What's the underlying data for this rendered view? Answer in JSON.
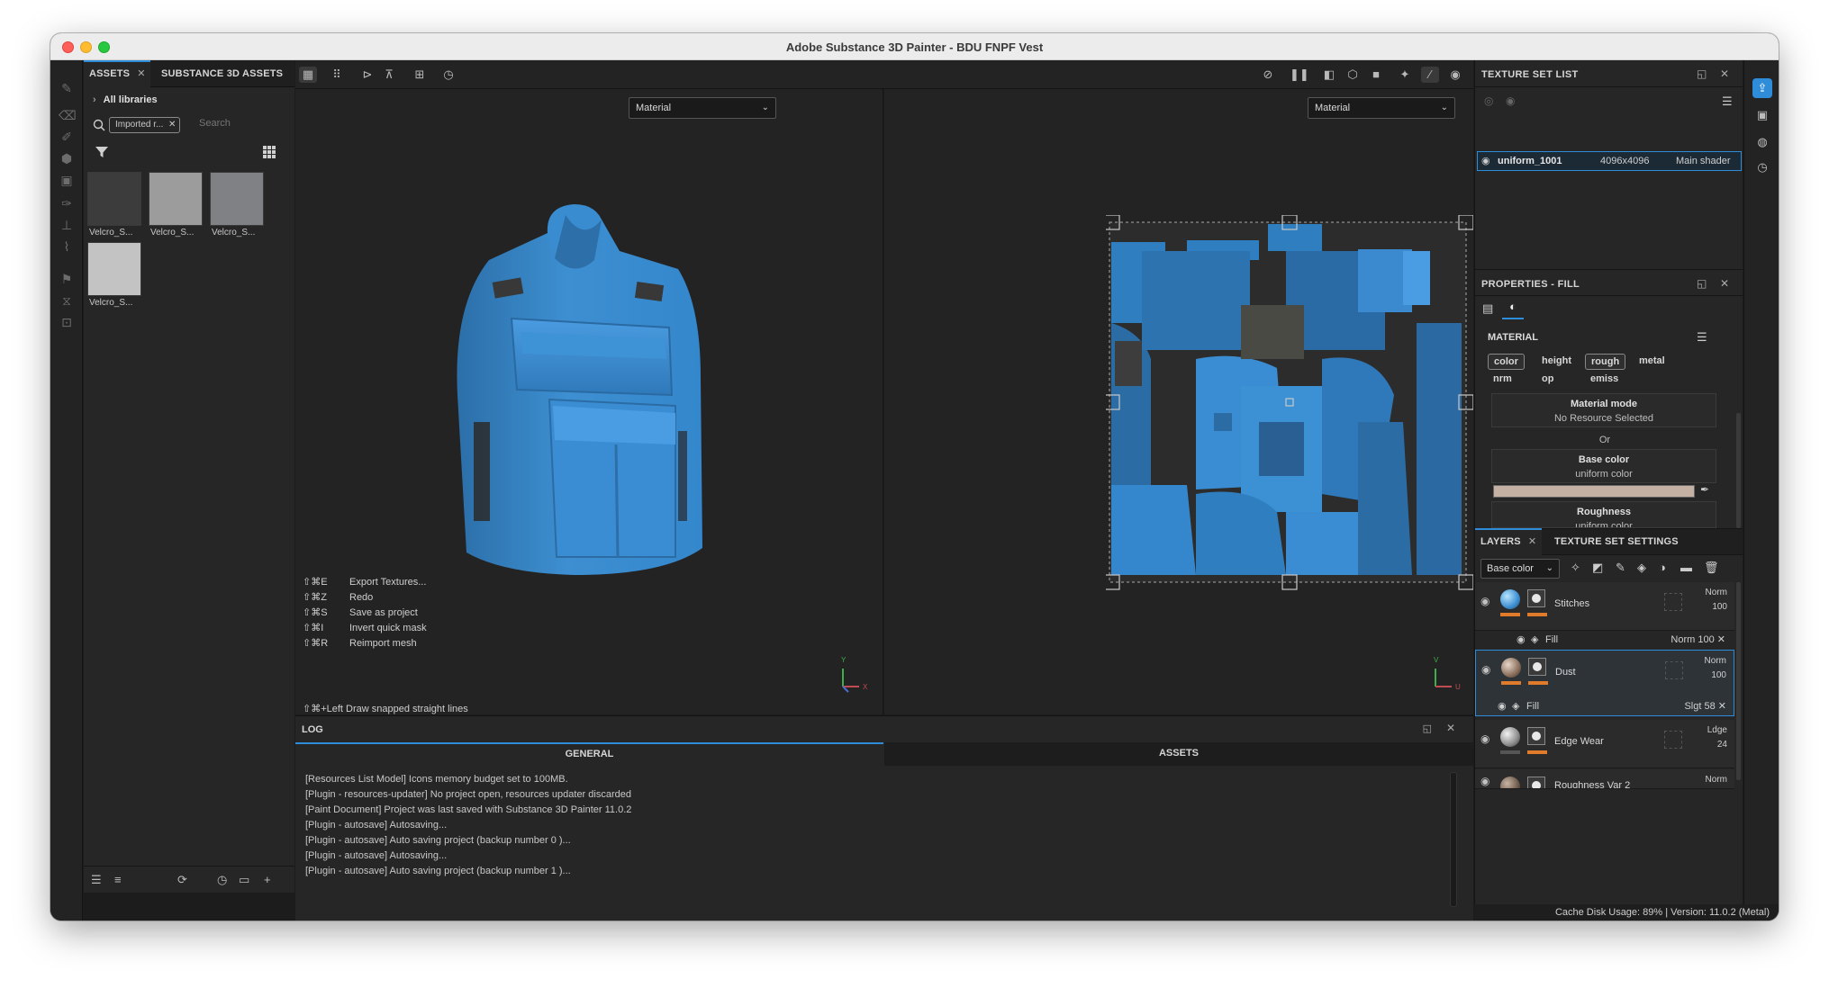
{
  "window": {
    "title": "Adobe Substance 3D Painter - BDU FNPF Vest"
  },
  "assets_panel": {
    "tabs": [
      {
        "label": "ASSETS",
        "close": "✕"
      },
      {
        "label": "SUBSTANCE 3D ASSETS"
      }
    ],
    "library": "All libraries",
    "filter_chip": "Imported r...",
    "search_placeholder": "Search",
    "thumbnails": [
      {
        "label": "Velcro_S...",
        "color": "#3c3c3c"
      },
      {
        "label": "Velcro_S...",
        "color": "#9c9c9c"
      },
      {
        "label": "Velcro_S...",
        "color": "#7f8184"
      },
      {
        "label": "Velcro_S...",
        "color": "#c3c3c3"
      }
    ]
  },
  "viewport3d": {
    "dropdown": "Material",
    "shortcuts": [
      {
        "keys": "⇧⌘E",
        "action": "Export Textures..."
      },
      {
        "keys": "⇧⌘Z",
        "action": "Redo"
      },
      {
        "keys": "⇧⌘S",
        "action": "Save as project"
      },
      {
        "keys": "⇧⌘I",
        "action": "Invert quick mask"
      },
      {
        "keys": "⇧⌘R",
        "action": "Reimport mesh"
      }
    ],
    "hint": "⇧⌘+Left  Draw snapped straight lines",
    "axis_y": "Y",
    "axis_x": "X"
  },
  "viewport2d": {
    "dropdown": "Material",
    "axis_v": "V",
    "axis_u": "U"
  },
  "log": {
    "title": "LOG",
    "tabs": [
      "GENERAL",
      "ASSETS"
    ],
    "lines": [
      "[Resources List Model] Icons memory budget set to 100MB.",
      "[Plugin - resources-updater] No project open, resources updater discarded",
      "[Paint Document] Project was last saved with Substance 3D Painter 11.0.2",
      "[Plugin - autosave] Autosaving...",
      "[Plugin - autosave] Auto saving project (backup number 0 )...",
      "[Plugin - autosave] Autosaving...",
      "[Plugin - autosave] Auto saving project (backup number 1 )..."
    ]
  },
  "texture_set_list": {
    "title": "TEXTURE SET LIST",
    "row": {
      "name": "uniform_1001",
      "size": "4096x4096",
      "shader": "Main shader"
    }
  },
  "properties": {
    "title": "PROPERTIES - FILL",
    "section": "MATERIAL",
    "channels_row1": [
      "color",
      "height",
      "rough",
      "metal"
    ],
    "channels_row2": [
      "nrm",
      "op",
      "emiss"
    ],
    "material_mode": {
      "title": "Material mode",
      "value": "No Resource Selected"
    },
    "or": "Or",
    "base_color": {
      "title": "Base color",
      "value": "uniform color",
      "swatch": "#c4b1a3"
    },
    "roughness": {
      "title": "Roughness",
      "value": "uniform color"
    }
  },
  "layers": {
    "tabs": [
      "LAYERS",
      "TEXTURE SET SETTINGS"
    ],
    "channel_select": "Base color",
    "items": [
      {
        "name": "Stitches",
        "blend": "Norm",
        "opacity": "100",
        "sub": {
          "name": "Fill",
          "blend": "Norm",
          "opacity": "100"
        }
      },
      {
        "name": "Dust",
        "blend": "Norm",
        "opacity": "100",
        "sub": {
          "name": "Fill",
          "blend": "Slgt",
          "opacity": "58"
        }
      },
      {
        "name": "Edge Wear",
        "blend": "Ldge",
        "opacity": "24"
      },
      {
        "name": "Roughness Var 2",
        "blend": "Norm"
      }
    ]
  },
  "status": {
    "text": "Cache Disk Usage:    89% | Version: 11.0.2 (Metal)"
  },
  "colors": {
    "accent": "#2f8cd8",
    "vest": "#3d8fd1",
    "layer_mark": "#e07b2c"
  }
}
